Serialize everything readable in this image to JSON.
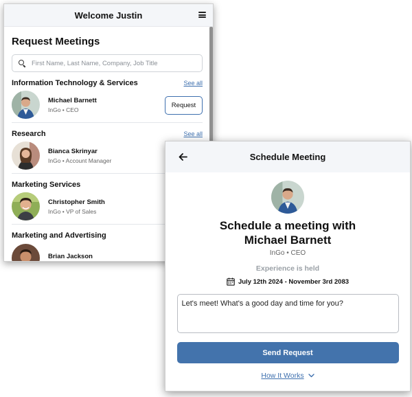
{
  "back_window": {
    "header_title": "Welcome Justin",
    "page_title": "Request Meetings",
    "search_placeholder": "First Name, Last Name, Company, Job Title",
    "sections": [
      {
        "title": "Information Technology & Services",
        "see_all": "See all",
        "person": {
          "name": "Michael Barnett",
          "subtitle": "InGo • CEO",
          "action": "Request"
        }
      },
      {
        "title": "Research",
        "see_all": "See all",
        "person": {
          "name": "Bianca Skrinyar",
          "subtitle": "InGo • Account Manager"
        }
      },
      {
        "title": "Marketing Services",
        "person": {
          "name": "Christopher Smith",
          "subtitle": "InGo • VP of Sales"
        }
      },
      {
        "title": "Marketing and Advertising",
        "person": {
          "name": "Brian Jackson",
          "subtitle": ""
        }
      }
    ]
  },
  "front_window": {
    "header_title": "Schedule Meeting",
    "heading_line1": "Schedule a meeting with",
    "heading_line2": "Michael Barnett",
    "subtitle": "InGo • CEO",
    "experience_label": "Experience is held",
    "date_range": "July 12th 2024 - November 3rd 2083",
    "message_value": "Let's meet! What's a good day and time for you?",
    "send_label": "Send Request",
    "how_it_works": "How It Works"
  },
  "colors": {
    "accent": "#4373ac",
    "link": "#3d6fae",
    "header_bg": "#f4f6f9"
  },
  "icons": [
    "hamburger-menu-icon",
    "search-icon",
    "back-arrow-icon",
    "calendar-icon",
    "chevron-down-icon"
  ]
}
